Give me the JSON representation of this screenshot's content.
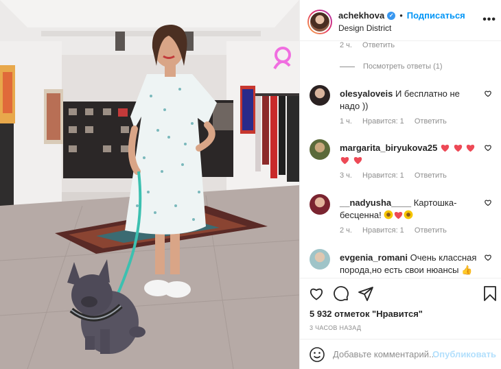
{
  "post": {
    "photo_alt": "Woman in a floral dress with a French bulldog on a leash in a store"
  },
  "header": {
    "username": "achekhova",
    "dot": "•",
    "follow_label": "Подписаться",
    "location": "Design District",
    "more": "•••"
  },
  "thread": {
    "top_meta_time": "2 ч.",
    "top_meta_reply": "Ответить",
    "view_replies": "Посмотреть ответы (1)"
  },
  "comments": [
    {
      "username": "olesyaloveis",
      "text": "И бесплатно не надо ))",
      "time": "1 ч.",
      "likes": "Нравится: 1",
      "reply": "Ответить"
    },
    {
      "username": "margarita_biryukova25",
      "text": "",
      "hearts": 5,
      "time": "3 ч.",
      "likes": "Нравится: 1",
      "reply": "Ответить"
    },
    {
      "username": "__nadyusha____",
      "text": "Картошка-бесценна!",
      "emoji": [
        "sunflower",
        "heart",
        "sunflower"
      ],
      "time": "2 ч.",
      "likes": "Нравится: 1",
      "reply": "Ответить"
    },
    {
      "username": "evgenia_romani",
      "text": "Очень классная порода,но есть свои нюансы",
      "emoji": [
        "thumbs-up"
      ]
    }
  ],
  "actions": {
    "likes": "5 932 отметок \"Нравится\"",
    "time_ago": "3 ЧАСОВ НАЗАД"
  },
  "add_comment": {
    "placeholder": "Добавьте комментарий...",
    "publish_label": "Опубликовать"
  },
  "colors": {
    "link_blue": "#0095f6",
    "publish_disabled": "#b2dffc",
    "heart_red": "#ed4956",
    "muted": "#8e8e8e"
  }
}
